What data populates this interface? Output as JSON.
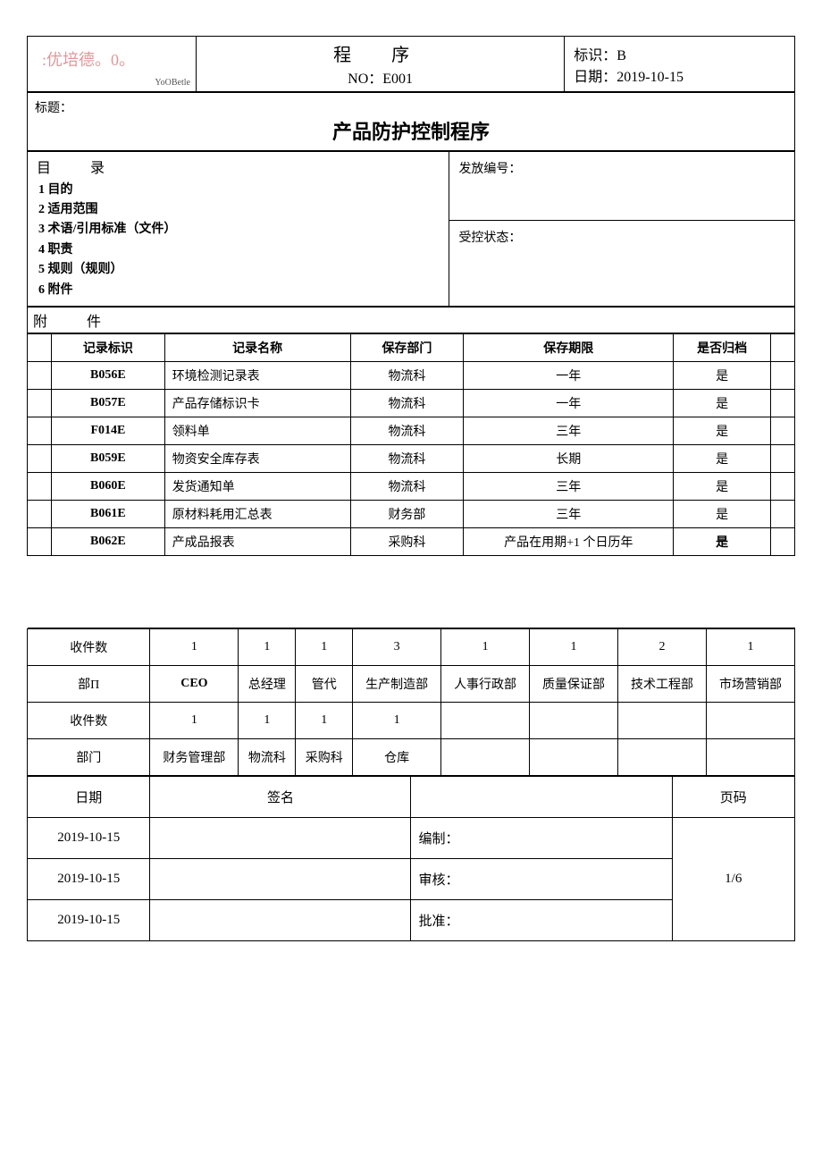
{
  "header": {
    "logo_main": ":优培德。0。",
    "logo_sub": "YoOBetle",
    "proc_label": "程 序",
    "no_label": "NO：E001",
    "id_label": "标识：B",
    "date_label": "日期：2019-10-15"
  },
  "title_row": {
    "label": "标题：",
    "main_title": "产品防护控制程序"
  },
  "toc": {
    "heading": "目 录",
    "items": [
      "1 目的",
      "2 适用范围",
      "3 术语/引用标准（文件）",
      "4 职责",
      "5 规则（规则）",
      "6 附件"
    ]
  },
  "right_box": {
    "issue_no": "发放编号：",
    "control_state": "受控状态："
  },
  "attachments": {
    "heading": "附 件",
    "columns": [
      "记录标识",
      "记录名称",
      "保存部门",
      "保存期限",
      "是否归档"
    ],
    "rows": [
      {
        "id": "B056E",
        "name": "环境检测记录表",
        "dept": "物流科",
        "period": "一年",
        "archive": "是"
      },
      {
        "id": "B057E",
        "name": "产品存储标识卡",
        "dept": "物流科",
        "period": "一年",
        "archive": "是"
      },
      {
        "id": "F014E",
        "name": "领料单",
        "dept": "物流科",
        "period": "三年",
        "archive": "是"
      },
      {
        "id": "B059E",
        "name": "物资安全库存表",
        "dept": "物流科",
        "period": "长期",
        "archive": "是"
      },
      {
        "id": "B060E",
        "name": "发货通知单",
        "dept": "物流科",
        "period": "三年",
        "archive": "是"
      },
      {
        "id": "B061E",
        "name": "原材料耗用汇总表",
        "dept": "财务部",
        "period": "三年",
        "archive": "是"
      },
      {
        "id": "B062E",
        "name": "产成品报表",
        "dept": "采购科",
        "period": "产品在用期+1 个日历年",
        "archive": "是"
      }
    ]
  },
  "distribution": {
    "count_label": "收件数",
    "dept_label": "部门",
    "dept_label_alt": "部Π",
    "row1_counts": [
      "1",
      "1",
      "1",
      "3",
      "1",
      "1",
      "2",
      "1"
    ],
    "row1_depts": [
      "CEO",
      "总经理",
      "管代",
      "生产制造部",
      "人事行政部",
      "质量保证部",
      "技术工程部",
      "市场营销部"
    ],
    "row2_counts": [
      "1",
      "1",
      "1",
      "1",
      "",
      "",
      "",
      ""
    ],
    "row2_depts": [
      "财务管理部",
      "物流科",
      "采购科",
      "仓库",
      "",
      "",
      "",
      ""
    ]
  },
  "signoff": {
    "date_label": "日期",
    "sign_label": "签名",
    "page_label": "页码",
    "rows": [
      {
        "date": "2019-10-15",
        "role": "编制："
      },
      {
        "date": "2019-10-15",
        "role": "审核："
      },
      {
        "date": "2019-10-15",
        "role": "批准："
      }
    ],
    "page_value": "1/6"
  }
}
